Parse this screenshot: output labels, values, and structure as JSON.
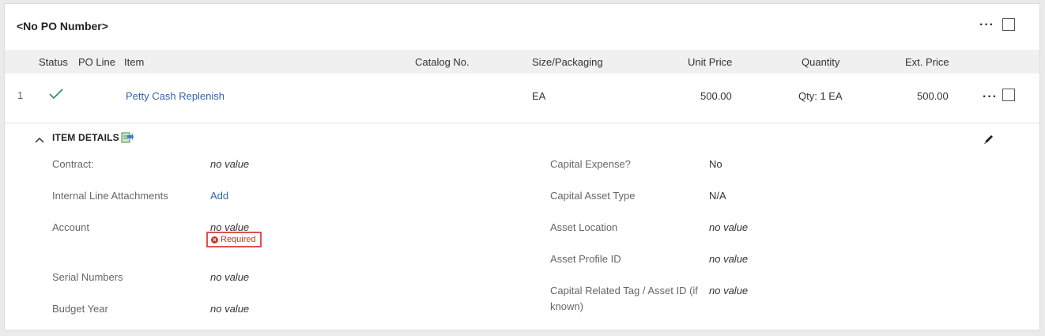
{
  "header": {
    "title": "<No PO Number>",
    "more_label": "···"
  },
  "columns": {
    "status": "Status",
    "po_line": "PO Line",
    "item": "Item",
    "catalog_no": "Catalog No.",
    "size_packaging": "Size/Packaging",
    "unit_price": "Unit Price",
    "quantity": "Quantity",
    "ext_price": "Ext. Price"
  },
  "line": {
    "number": "1",
    "status_icon": "check-icon",
    "item": "Petty Cash Replenish",
    "catalog_no": "",
    "size_packaging": "EA",
    "unit_price": "500.00",
    "quantity": "Qty: 1 EA",
    "ext_price": "500.00",
    "more_label": "···"
  },
  "item_details": {
    "section_title": "ITEM DETAILS",
    "left": {
      "contract_label": "Contract:",
      "contract_value": "no value",
      "attachments_label": "Internal Line Attachments",
      "attachments_action": "Add",
      "account_label": "Account",
      "account_value": "no value",
      "account_required": "Required",
      "serial_label": "Serial Numbers",
      "serial_value": "no value",
      "budget_label": "Budget Year",
      "budget_value": "no value"
    },
    "right": {
      "capital_expense_label": "Capital Expense?",
      "capital_expense_value": "No",
      "asset_type_label": "Capital Asset Type",
      "asset_type_value": "N/A",
      "asset_location_label": "Asset Location",
      "asset_location_value": "no value",
      "asset_profile_label": "Asset Profile ID",
      "asset_profile_value": "no value",
      "tag_label_line1": "Capital Related Tag / Asset ID (if",
      "tag_label_line2": "known)",
      "tag_value": "no value"
    }
  },
  "colors": {
    "link": "#3264a8",
    "status_check": "#2e8b57",
    "required": "#d9534f"
  }
}
